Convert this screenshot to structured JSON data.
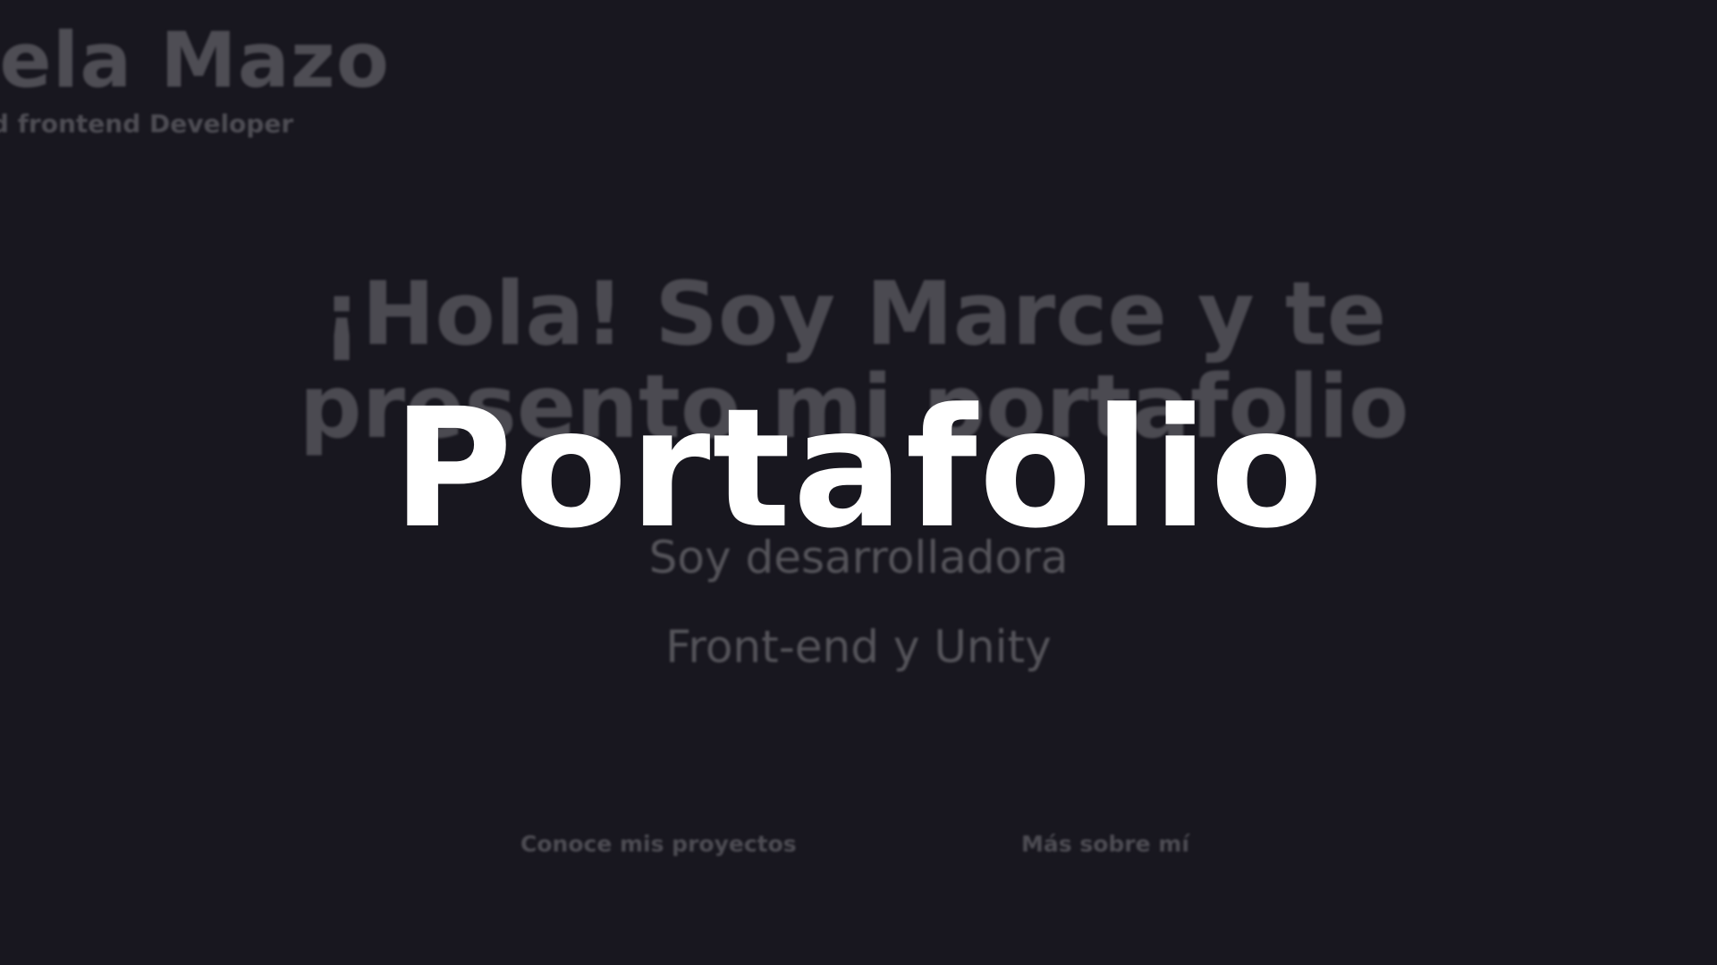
{
  "header": {
    "brand_name": "rcela Mazo",
    "brand_subtitle": "nd frontend Developer"
  },
  "hero": {
    "greeting": "¡Hola! Soy Marce y te presento mi portafolio",
    "tagline_line1": "Soy desarrolladora",
    "tagline_line2": "Front-end y Unity"
  },
  "actions": {
    "projects_label": "Conoce mis proyectos",
    "about_label": "Más sobre mí"
  },
  "overlay": {
    "title": "Portafolio"
  },
  "colors": {
    "background": "#18171f",
    "muted_text": "#4e4d54",
    "overlay_text": "#ffffff"
  }
}
